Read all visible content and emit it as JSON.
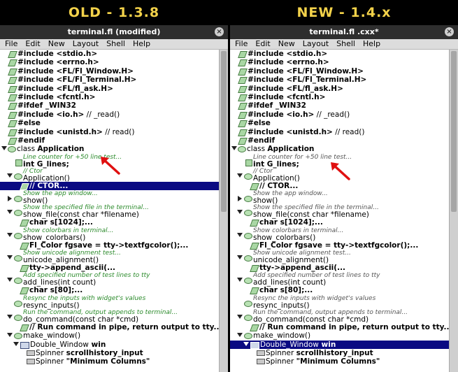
{
  "captions": {
    "left": "OLD - 1.3.8",
    "right": "NEW - 1.4.x"
  },
  "left": {
    "title": "terminal.fl (modified)",
    "close_glyph": "×",
    "menu": [
      "File",
      "Edit",
      "New",
      "Layout",
      "Shell",
      "Help"
    ]
  },
  "right": {
    "title": "terminal.fl  .cxx*",
    "close_glyph": "×",
    "menu": [
      "File",
      "Edit",
      "New",
      "Layout",
      "Shell",
      "Help"
    ]
  },
  "tree": {
    "inc_stdio": "#include <stdio.h>",
    "inc_errno": "#include <errno.h>",
    "inc_window": "#include <FL/Fl_Window.H>",
    "inc_terminal": "#include <FL/Fl_Terminal.H>",
    "inc_ask": "#include <FL/fl_ask.H>",
    "inc_fcntl": "#include <fcntl.h>",
    "ifdef": "#ifdef _WIN32",
    "inc_io": "#include <io.h>",
    "inc_io_comment": " // _read()",
    "else": "#else",
    "inc_unistd": "#include <unistd.h>",
    "inc_unistd_comment": " // read()",
    "endif": "#endif",
    "class_kw": "class ",
    "class_name": "Application",
    "g_lines_comment": "Line counter for +50 line test...",
    "g_lines": "int G_lines;",
    "ctor_comment": "// Ctor",
    "ctor_func": "Application()",
    "ctor_body": "// CTOR...",
    "show_comment": "Show the app window...",
    "show_func": "show()",
    "showfile_comment": "Show the specified file in the terminal...",
    "showfile_func": "show_file(const char *filename)",
    "showfile_body": "char s[1024];...",
    "colorbars_comment": "Show colorbars in terminal...",
    "colorbars_func": "show_colorbars()",
    "colorbars_body": "Fl_Color fgsave = tty->textfgcolor();...",
    "unicode_comment": "Show unicode alignment test...",
    "unicode_func": "unicode_alignment()",
    "unicode_body": "tty->append_ascii(...",
    "addlines_comment": "Add specified number of test lines to tty",
    "addlines_func": "add_lines(int count)",
    "addlines_body": "char s[80];...",
    "resync_comment": "Resync the inputs with widget's values",
    "resync_func": "resync_inputs()",
    "docmd_comment": "Run the command, output appends to terminal...",
    "docmd_func": "do_command(const char *cmd)",
    "docmd_body": "// Run command in pipe, return output to tty...",
    "makewin_func": "make_window()",
    "dw_kw": "Double_Window",
    "dw_name": "  win",
    "spin1_kw": "Spinner ",
    "spin1_name": "scrollhistory_input",
    "spin2_kw": "Spinner ",
    "spin2_name": "\"Minimum Columns\""
  },
  "colors": {
    "caption": "#f3d24a",
    "comment_green": "#2a8a2a",
    "selection": "#0a0a82",
    "arrow": "#e01010"
  }
}
